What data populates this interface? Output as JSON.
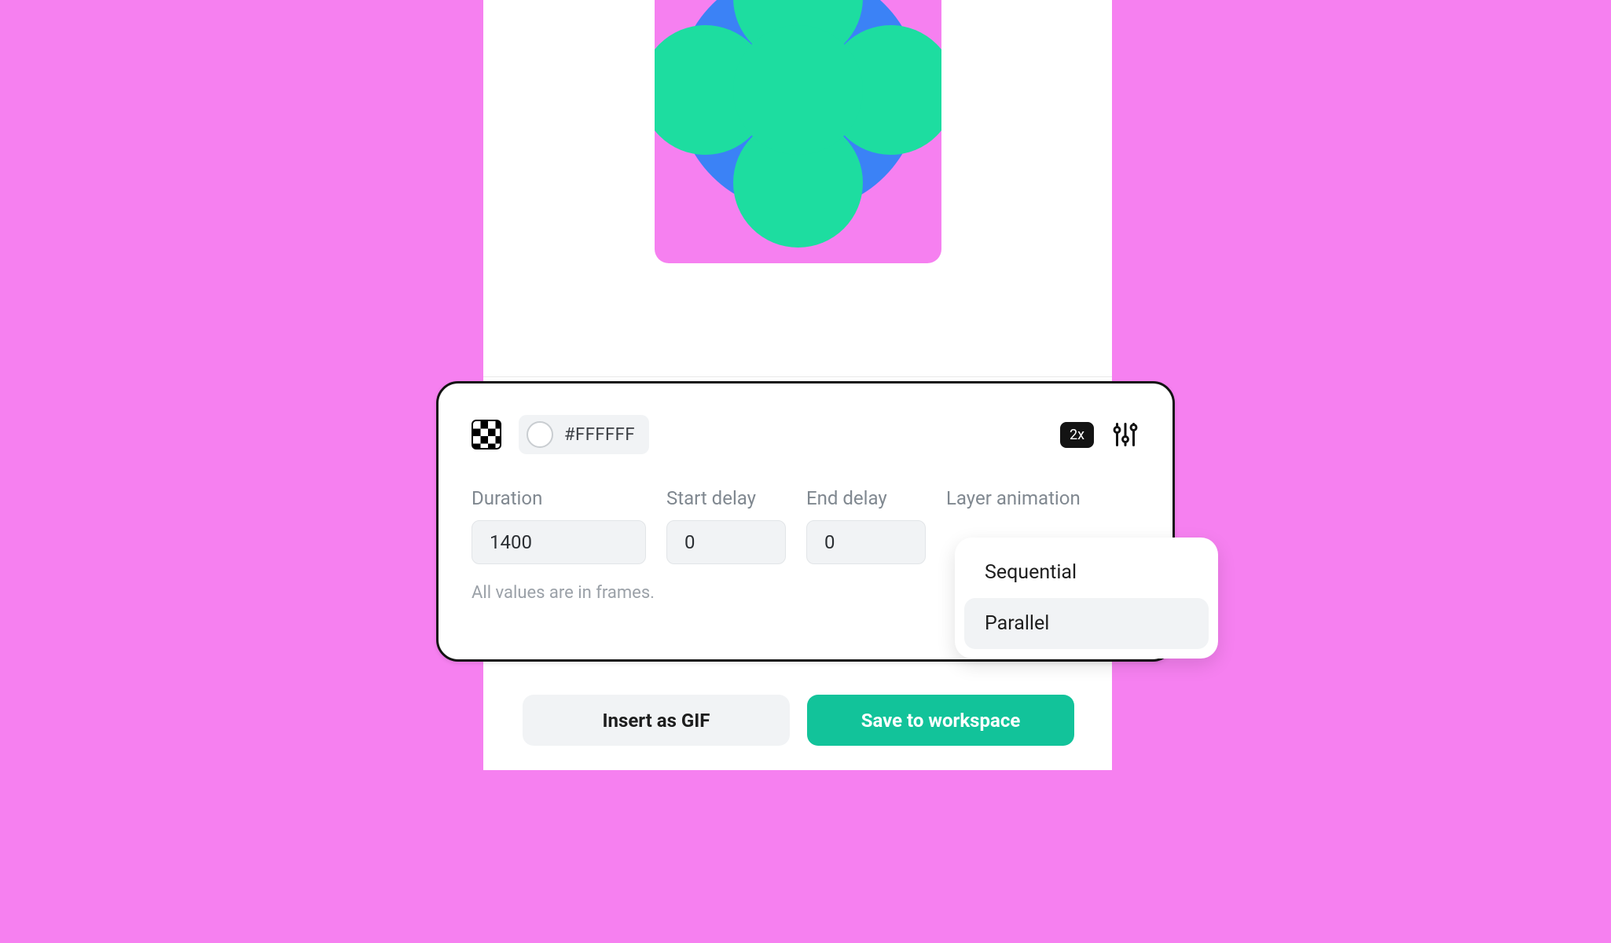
{
  "preview": {
    "tile_bg": "#F680F0",
    "blue": "#3B82F6",
    "green": "#1DDDA0"
  },
  "settings": {
    "color_value": "#FFFFFF",
    "scale_label": "2x",
    "fields": {
      "duration": {
        "label": "Duration",
        "value": "1400"
      },
      "start_delay": {
        "label": "Start delay",
        "value": "0"
      },
      "end_delay": {
        "label": "End delay",
        "value": "0"
      },
      "layer_animation": {
        "label": "Layer animation"
      }
    },
    "hint": "All values are in frames."
  },
  "dropdown": {
    "options": [
      {
        "label": "Sequential",
        "selected": false
      },
      {
        "label": "Parallel",
        "selected": true
      }
    ]
  },
  "actions": {
    "insert_label": "Insert as GIF",
    "save_label": "Save to workspace"
  },
  "colors": {
    "page_bg": "#F680F0",
    "accent": "#12C39A"
  }
}
